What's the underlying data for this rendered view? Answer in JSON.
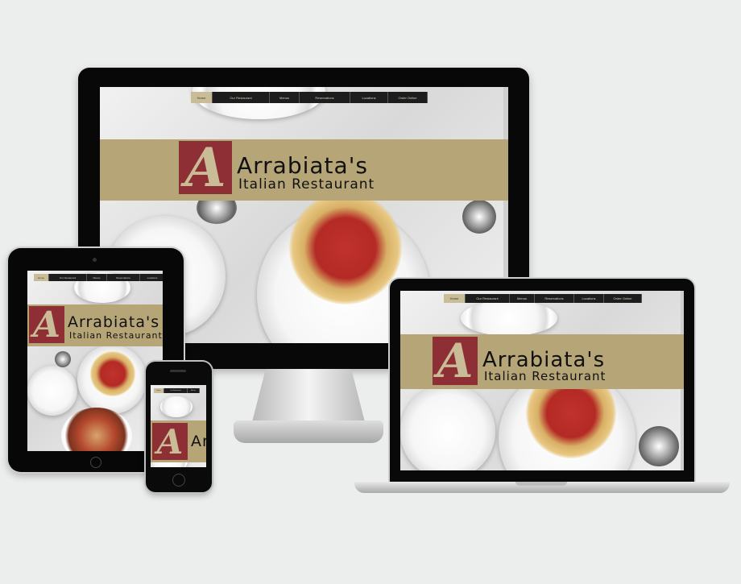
{
  "site": {
    "name": "Arrabiata's",
    "subtitle": "Italian Restaurant",
    "logo_letter": "A",
    "nav": [
      "Home",
      "Our Restaurant",
      "Menus",
      "Reservations",
      "Locations",
      "Order Online"
    ],
    "active_nav": "Home"
  },
  "colors": {
    "band": "#b6a577",
    "logo": "#8e2f35",
    "nav_bg": "#1d1d1d",
    "nav_active": "#c9bd97",
    "background": "#eceeee"
  }
}
